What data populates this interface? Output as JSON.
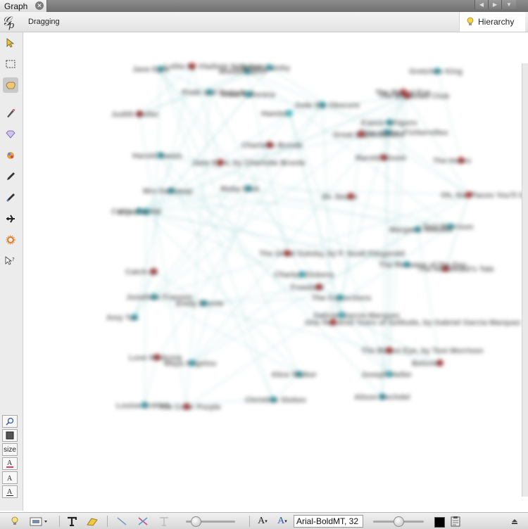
{
  "tab": {
    "label": "Graph",
    "close_icon": "close-icon"
  },
  "header": {
    "status": "Dragging",
    "hierarchy_label": "Hierarchy",
    "hierarchy_icon": "lightbulb-icon"
  },
  "left_toolbar": {
    "tools": [
      "select-arrow-icon",
      "rectangle-select-icon",
      "drag-hand-icon",
      "paintbrush-icon",
      "diamond-icon",
      "node-painter-icon",
      "pencil-icon",
      "edge-pencil-icon",
      "airplane-icon",
      "sun-gear-icon",
      "help-cursor-icon"
    ],
    "bottom_tools": [
      "zoom-icon",
      "square-icon",
      "size",
      "font-color-icon",
      "font-icon",
      "font-size-icon"
    ],
    "size_label": "size"
  },
  "bottom_toolbar": {
    "font_value": "Arial-BoldMT, 32",
    "text_a_small": "A",
    "text_a_blue": "A",
    "node_size_fraction": 0.2,
    "label_size_fraction": 0.5
  },
  "colors": {
    "node_blue": "#4fb9c4",
    "node_red": "#c94a4a",
    "edge": "#9fd3d4",
    "tab_bar": "#7c7c7c"
  },
  "graph": {
    "nodes": [
      {
        "label": "Lolita by Vladimir Nabokov",
        "c": "red"
      },
      {
        "label": "Middlemarch",
        "c": "blue"
      },
      {
        "label": "Great Gatsby",
        "c": "blue"
      },
      {
        "label": "Jane Eyre",
        "c": "blue"
      },
      {
        "label": "Pride and Prejudice",
        "c": "blue"
      },
      {
        "label": "Anna Karenina",
        "c": "blue"
      },
      {
        "label": "Hamlet",
        "c": "blue"
      },
      {
        "label": "Jude the Obscure",
        "c": "blue"
      },
      {
        "label": "Judith Butler",
        "c": "red"
      },
      {
        "label": "The Bluest Eye",
        "c": "red"
      },
      {
        "label": "Gretchen King",
        "c": "blue"
      },
      {
        "label": "The Breakfast Club",
        "c": "red"
      },
      {
        "label": "Kazuo Ishiguro",
        "c": "blue"
      },
      {
        "label": "Tess of the d'Urbervilles",
        "c": "blue"
      },
      {
        "label": "Great Expectations",
        "c": "red"
      },
      {
        "label": "Harold Bloom",
        "c": "red"
      },
      {
        "label": "Harold Ramis",
        "c": "blue"
      },
      {
        "label": "Jane Eyre, by Charlotte Bronte",
        "c": "red"
      },
      {
        "label": "Charlotte Bronte",
        "c": "red"
      },
      {
        "label": "The Hours",
        "c": "red"
      },
      {
        "label": "Mrs Dalloway",
        "c": "blue"
      },
      {
        "label": "Moby Dick",
        "c": "blue"
      },
      {
        "label": "Ulysses",
        "c": "blue"
      },
      {
        "label": "Cat in the Hat",
        "c": "blue"
      },
      {
        "label": "Oh, the Places You'll Go, by Dr. Seuss",
        "c": "red"
      },
      {
        "label": "Dr. Seuss",
        "c": "red"
      },
      {
        "label": "Margaret Atwood",
        "c": "blue"
      },
      {
        "label": "Toni Morrison",
        "c": "blue"
      },
      {
        "label": "The Handmaid's Tale",
        "c": "red"
      },
      {
        "label": "The Remains of the Day",
        "c": "blue"
      },
      {
        "label": "The Great Gatsby, by F. Scott Fitzgerald",
        "c": "red"
      },
      {
        "label": "Charles Dickens",
        "c": "blue"
      },
      {
        "label": "Catch-22",
        "c": "red"
      },
      {
        "label": "Jonathan Franzen",
        "c": "blue"
      },
      {
        "label": "Emily Bronte",
        "c": "blue"
      },
      {
        "label": "Freedom",
        "c": "red"
      },
      {
        "label": "The Corrections",
        "c": "blue"
      },
      {
        "label": "Amy Tan",
        "c": "blue"
      },
      {
        "label": "One Hundred Years of Solitude, by Gabriel Garcia Marquez",
        "c": "red"
      },
      {
        "label": "Gabriel Garcia Marquez",
        "c": "blue"
      },
      {
        "label": "The Bluest Eye, by Toni Morrison",
        "c": "red"
      },
      {
        "label": "Maya Angelou",
        "c": "blue"
      },
      {
        "label": "Love Medicine",
        "c": "red"
      },
      {
        "label": "Alice Walker",
        "c": "blue"
      },
      {
        "label": "Joseph Heller",
        "c": "blue"
      },
      {
        "label": "Beloved",
        "c": "red"
      },
      {
        "label": "Christine Stokes",
        "c": "blue"
      },
      {
        "label": "Alison Bechdel",
        "c": "blue"
      },
      {
        "label": "Louise Erdrich",
        "c": "blue"
      },
      {
        "label": "The Color Purple",
        "c": "red"
      }
    ],
    "edge_count": 90
  }
}
